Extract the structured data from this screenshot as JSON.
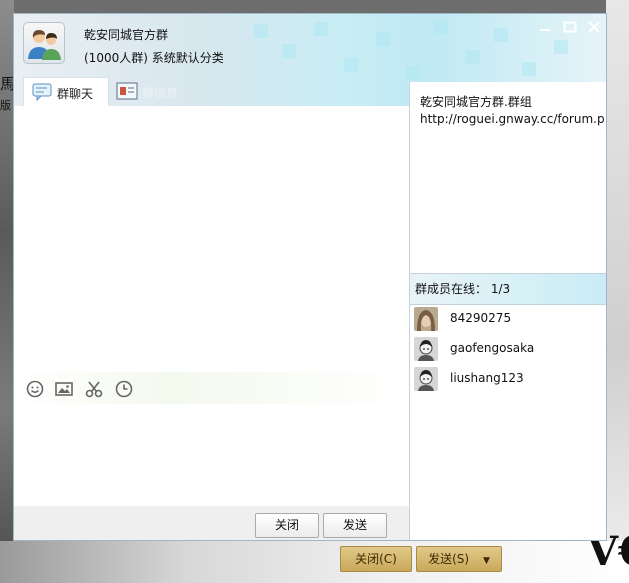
{
  "background": {
    "left_fragments": [
      "馬",
      "版"
    ],
    "close_label": "关闭(C)",
    "send_label": "发送(S)"
  },
  "window": {
    "group_name": "乾安同城官方群",
    "group_sub": "(1000人群)  系统默认分类",
    "controls": [
      "minimize-icon",
      "maximize-icon",
      "close-icon"
    ]
  },
  "tabs": [
    {
      "label": "群聊天",
      "icon": "chat-bubble-icon"
    },
    {
      "label": "群信息",
      "icon": "group-card-icon"
    }
  ],
  "toolbar": {
    "icons": [
      "emoji-icon",
      "image-icon",
      "scissors-icon",
      "clock-icon"
    ]
  },
  "bottom": {
    "close_label": "关闭",
    "send_label": "发送"
  },
  "announcement": {
    "line1": "乾安同城官方群.群组",
    "line2": "http://roguei.gnway.cc/forum.p"
  },
  "members": {
    "header_label": "群成员在线：",
    "online_count": "1/3",
    "list": [
      {
        "name": "84290275",
        "avatar": "photo-avatar"
      },
      {
        "name": "gaofengosaka",
        "avatar": "default-avatar"
      },
      {
        "name": "liushang123",
        "avatar": "default-avatar"
      }
    ]
  },
  "colors": {
    "accent": "#bfe9f3",
    "bg_button": "#c9a85a"
  }
}
